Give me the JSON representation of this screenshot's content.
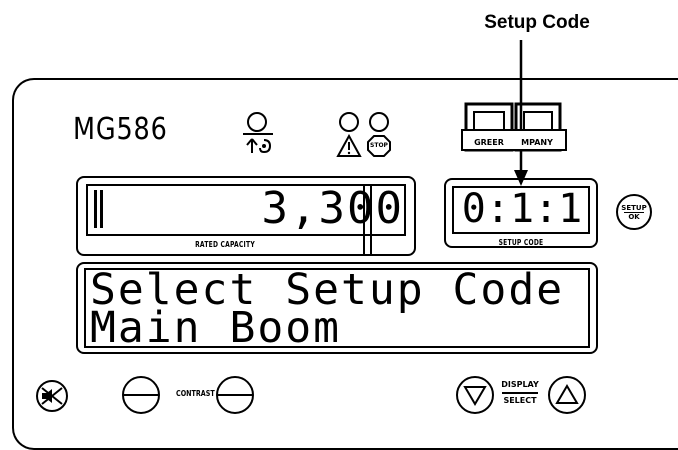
{
  "callout": {
    "label": "Setup Code"
  },
  "panel": {
    "model": "MG586",
    "capacity_display": {
      "value": "3,300",
      "caption": "RATED CAPACITY"
    },
    "setup_code_display": {
      "value": "0:1:1",
      "caption": "SETUP CODE"
    },
    "setup_button": {
      "line1": "SETUP",
      "line2": "OK"
    },
    "stop_label": "STOP",
    "logo": {
      "left_text": "GREER",
      "right_text": "MPANY"
    },
    "message": {
      "line1": "Select Setup Code",
      "line2": "Main Boom"
    },
    "contrast_label": "CONTRAST",
    "display_select": {
      "line1": "DISPLAY",
      "line2": "SELECT"
    }
  },
  "icons": [
    "anti-two-block-icon",
    "warning-icon",
    "stop-icon",
    "mute-icon",
    "arrow-down-icon",
    "arrow-up-icon"
  ]
}
